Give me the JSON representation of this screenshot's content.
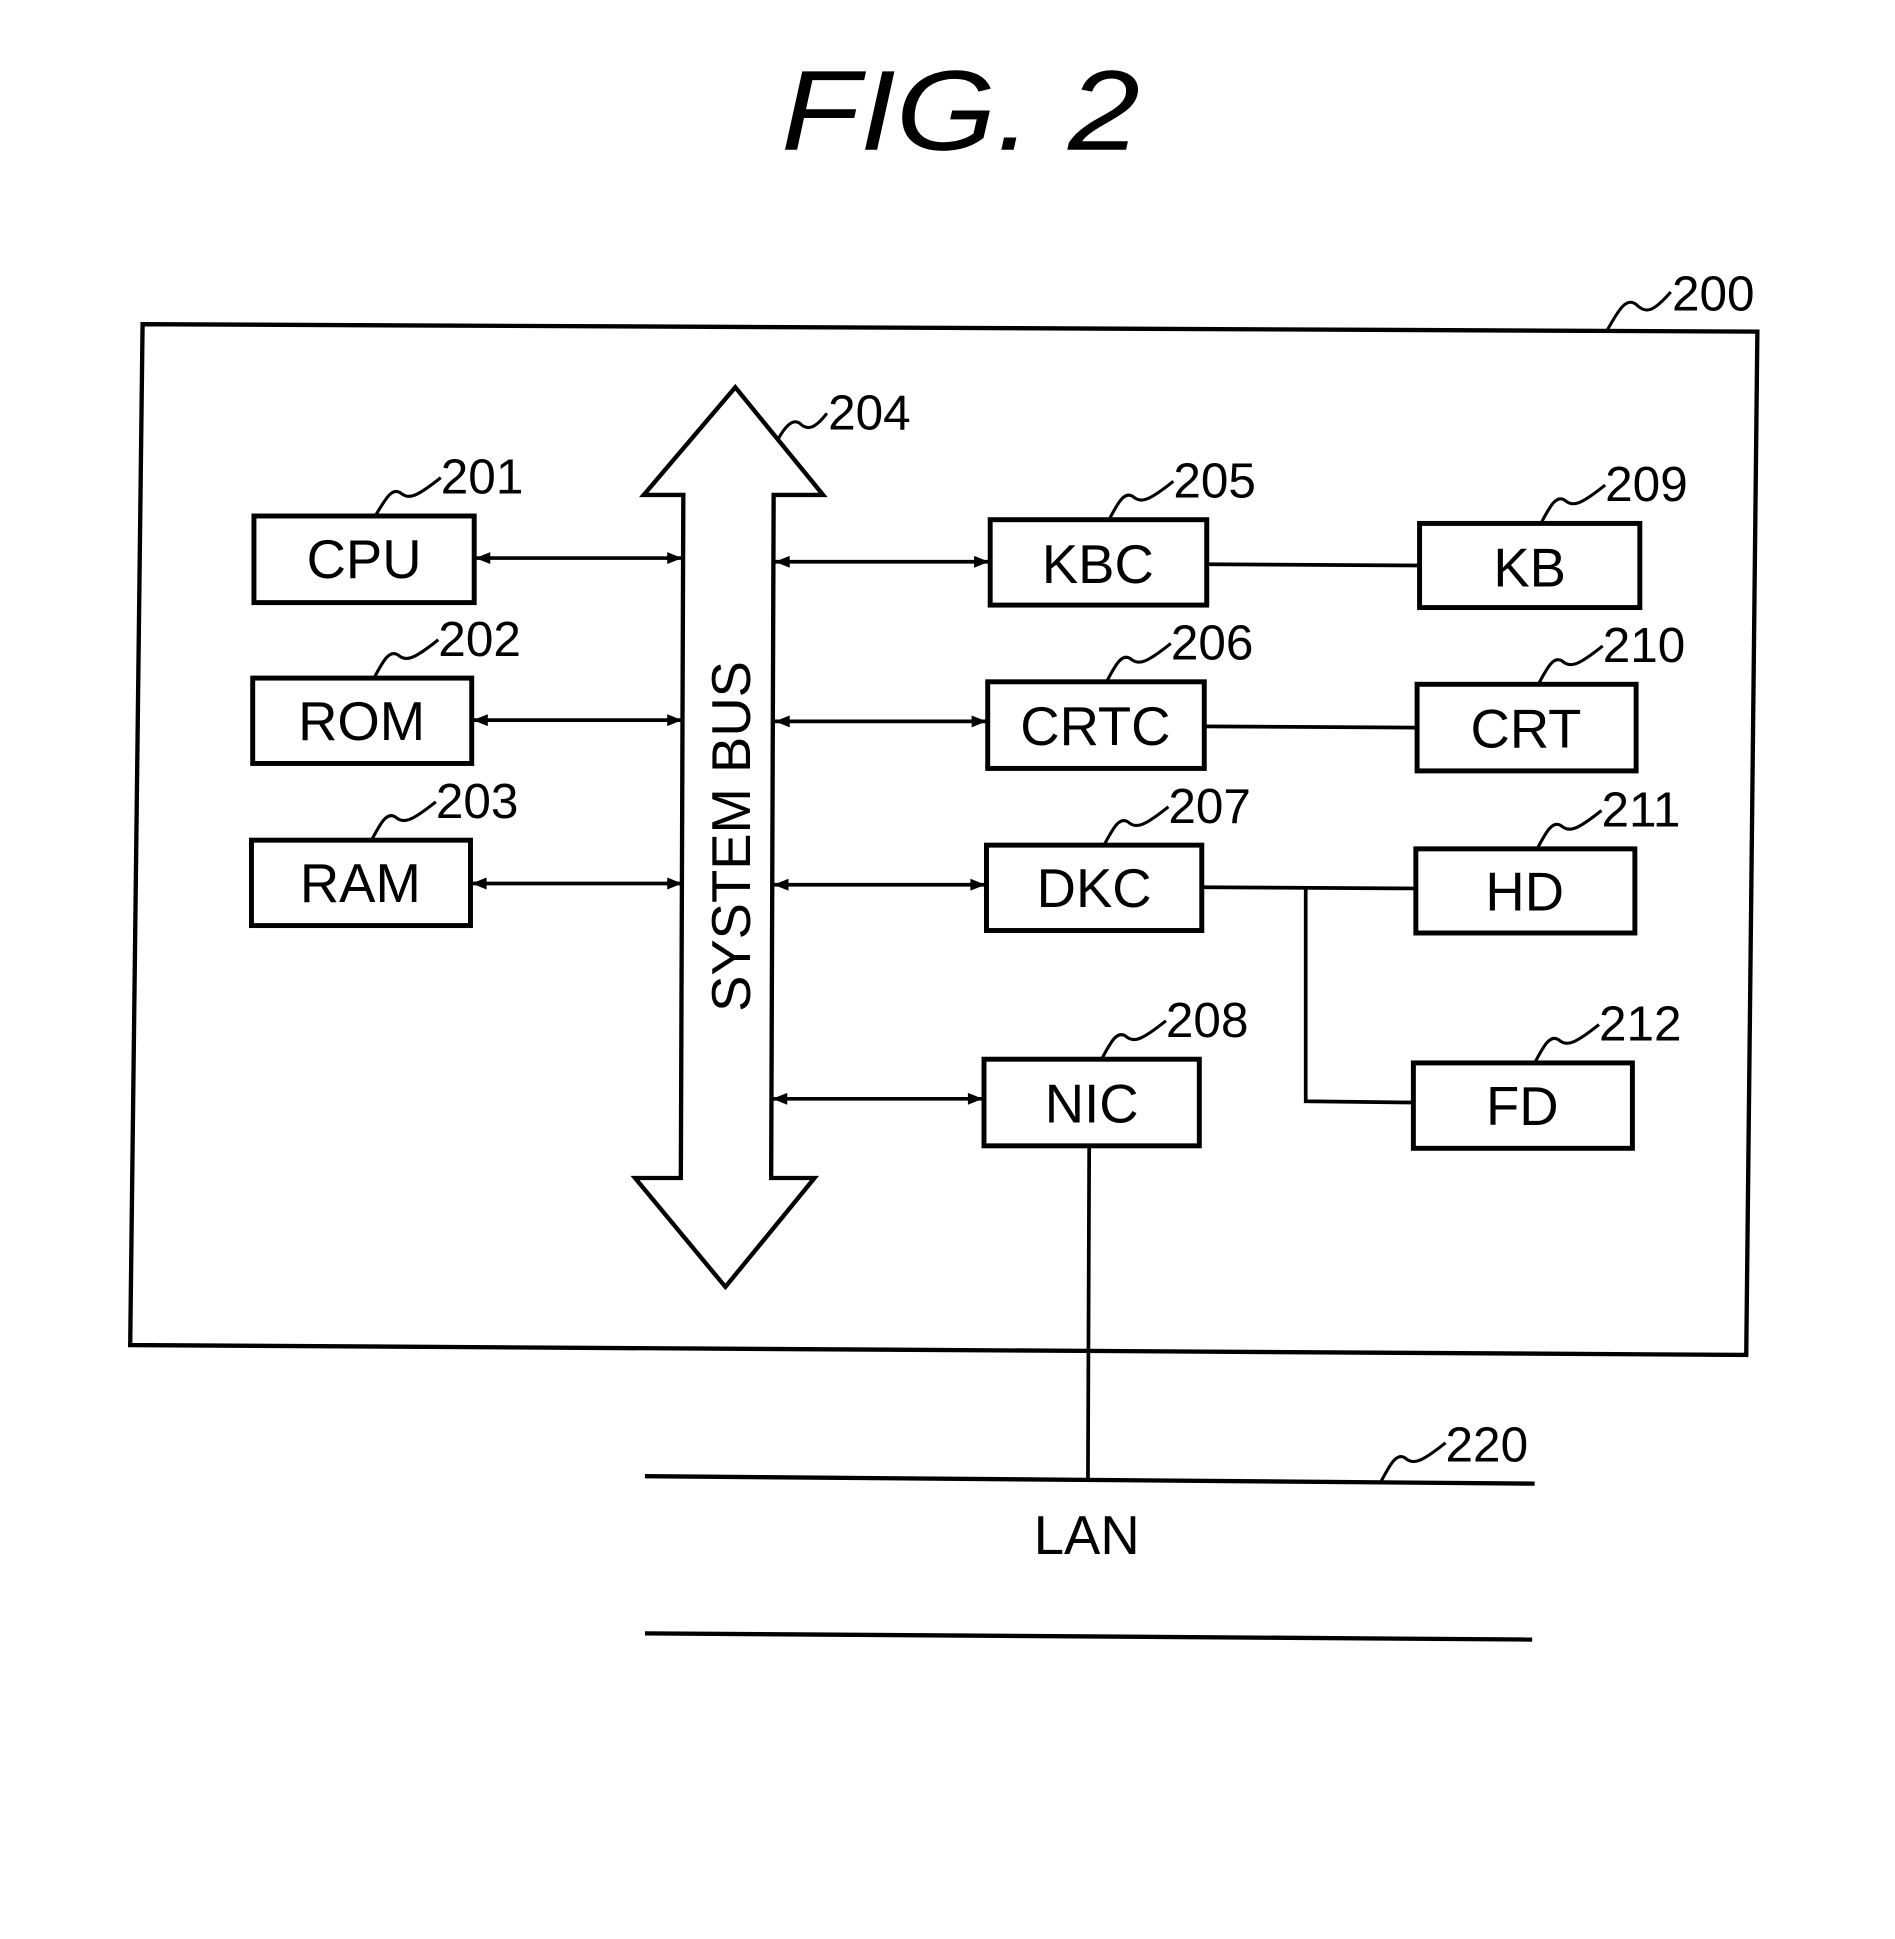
{
  "figure": {
    "title": "FIG. 2",
    "system": {
      "ref": "200"
    },
    "bus": {
      "label": "SYSTEM BUS",
      "ref": "204"
    },
    "left_blocks": [
      {
        "id": "cpu",
        "label": "CPU",
        "ref": "201"
      },
      {
        "id": "rom",
        "label": "ROM",
        "ref": "202"
      },
      {
        "id": "ram",
        "label": "RAM",
        "ref": "203"
      }
    ],
    "controllers": [
      {
        "id": "kbc",
        "label": "KBC",
        "ref": "205"
      },
      {
        "id": "crtc",
        "label": "CRTC",
        "ref": "206"
      },
      {
        "id": "dkc",
        "label": "DKC",
        "ref": "207"
      },
      {
        "id": "nic",
        "label": "NIC",
        "ref": "208"
      }
    ],
    "devices": [
      {
        "id": "kb",
        "label": "KB",
        "ref": "209"
      },
      {
        "id": "crt",
        "label": "CRT",
        "ref": "210"
      },
      {
        "id": "hd",
        "label": "HD",
        "ref": "211"
      },
      {
        "id": "fd",
        "label": "FD",
        "ref": "212"
      }
    ],
    "network": {
      "label": "LAN",
      "ref": "220"
    }
  }
}
